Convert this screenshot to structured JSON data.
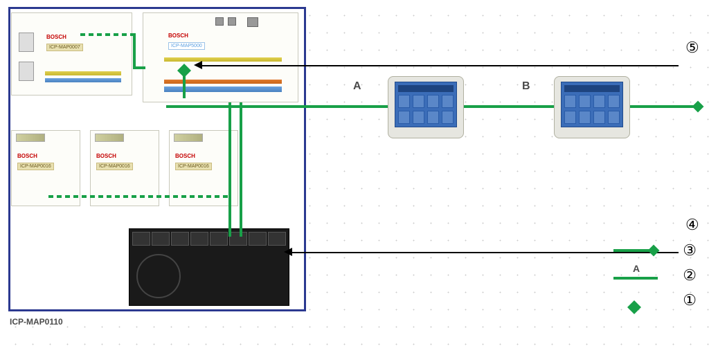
{
  "enclosure_label": "ICP-MAP0110",
  "brand": "BOSCH",
  "modules": {
    "map0007": "ICP-MAP0007",
    "map5000": "ICP-MAP5000",
    "map0016": "ICP-MAP0016"
  },
  "segments": {
    "A": "A",
    "B": "B"
  },
  "callouts": {
    "c1": "①",
    "c2": "②",
    "c3": "③",
    "c4": "④",
    "c5": "⑤"
  },
  "legend": {
    "a_label": "A"
  }
}
